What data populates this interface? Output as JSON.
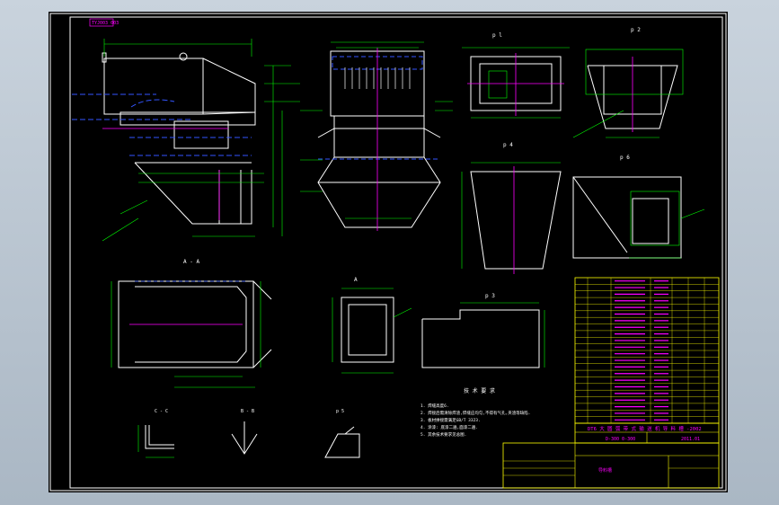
{
  "colors": {
    "viewport_bg": "#b8c4d0",
    "sheet_bg": "#000000",
    "frame": "#ffffff",
    "geometry": "#ffffff",
    "dimension": "#00ff00",
    "centerline": "#ff00ff",
    "hidden": "#3355ff",
    "table_grid": "#ffff00",
    "table_text": "#ff00ff",
    "leader": "#00ff00",
    "red_text": "#ff3333"
  },
  "drawing": {
    "title_tag": "TYJ003 003",
    "view_labels": {
      "pl": "p l",
      "p2": "p 2",
      "p4": "p 4",
      "p6": "p 6",
      "p3": "p 3",
      "a_a": "A - A",
      "c_c": "C - C",
      "b_b": "B - B",
      "p5": "p 5",
      "a_label": "A",
      "one": "1:1"
    },
    "tech_title": "技 术 要 求",
    "tech_notes": [
      "1. 焊缝高度6.",
      "2. 焊接后需清除焊渣,焊缝应均匀,不得有气孔,夹渣等缺陷.",
      "3. 板材拼接需满足GB/T 3323.",
      "4. 涂漆: 底漆二遍,面漆二遍.",
      "5. 其余技术要求见总图."
    ],
    "title_block": {
      "project": "DT6 大 圆 弧 带 式 输 送 机 导 料 槽 -2002",
      "drawing_no": "D-300 0-300",
      "date": "2011.01",
      "name": "导料槽"
    }
  }
}
